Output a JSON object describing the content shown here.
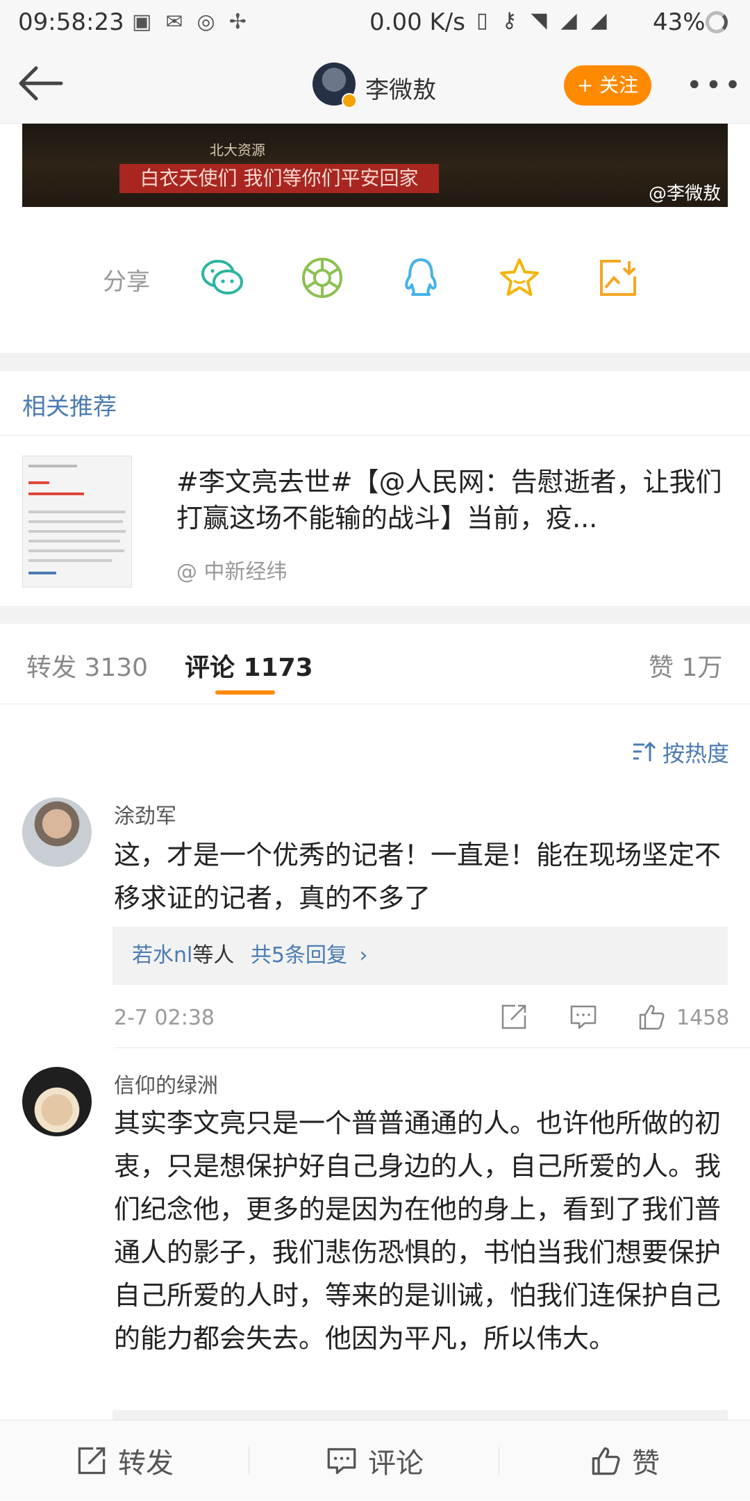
{
  "status_bar": {
    "time": "09:58:23",
    "net_speed": "0.00 K/s",
    "battery": "43%"
  },
  "nav": {
    "user_name": "李微敖",
    "follow_label": "+ 关注"
  },
  "photo": {
    "banner_text": "白衣天使们  我们等你们平安回家",
    "brand_text": "北大资源",
    "watermark": "@李微敖"
  },
  "share": {
    "label": "分享",
    "icons": [
      "wechat-icon",
      "moments-icon",
      "qq-icon",
      "favorite-icon",
      "save-image-icon"
    ]
  },
  "related": {
    "header": "相关推荐",
    "item": {
      "title": "#李文亮去世#【@人民网：告慰逝者，让我们打赢这场不能输的战斗】当前，疫...",
      "source": "@ 中新经纬"
    }
  },
  "tabs": {
    "repost": "转发 3130",
    "comment": "评论 1173",
    "like": "赞 1万"
  },
  "sort_label": "按热度",
  "comments": [
    {
      "user": "涂劲军",
      "text": "这，才是一个优秀的记者！一直是！能在现场坚定不移求证的记者，真的不多了",
      "reply_users": "若水nl",
      "reply_mid": "等人",
      "reply_count": "共5条回复",
      "time": "2-7 02:38",
      "likes": "1458"
    },
    {
      "user": "信仰的绿洲",
      "text": "其实李文亮只是一个普普通通的人。也许他所做的初衷，只是想保护好自己身边的人，自己所爱的人。我们纪念他，更多的是因为在他的身上，看到了我们普通人的影子，我们悲伤恐惧的，书怕当我们想要保护自己所爱的人时，等来的是训诫，怕我们连保护自己的能力都会失去。他因为平凡，所以伟大。"
    }
  ],
  "bottom_bar": {
    "repost": "转发",
    "comment": "评论",
    "like": "赞"
  }
}
